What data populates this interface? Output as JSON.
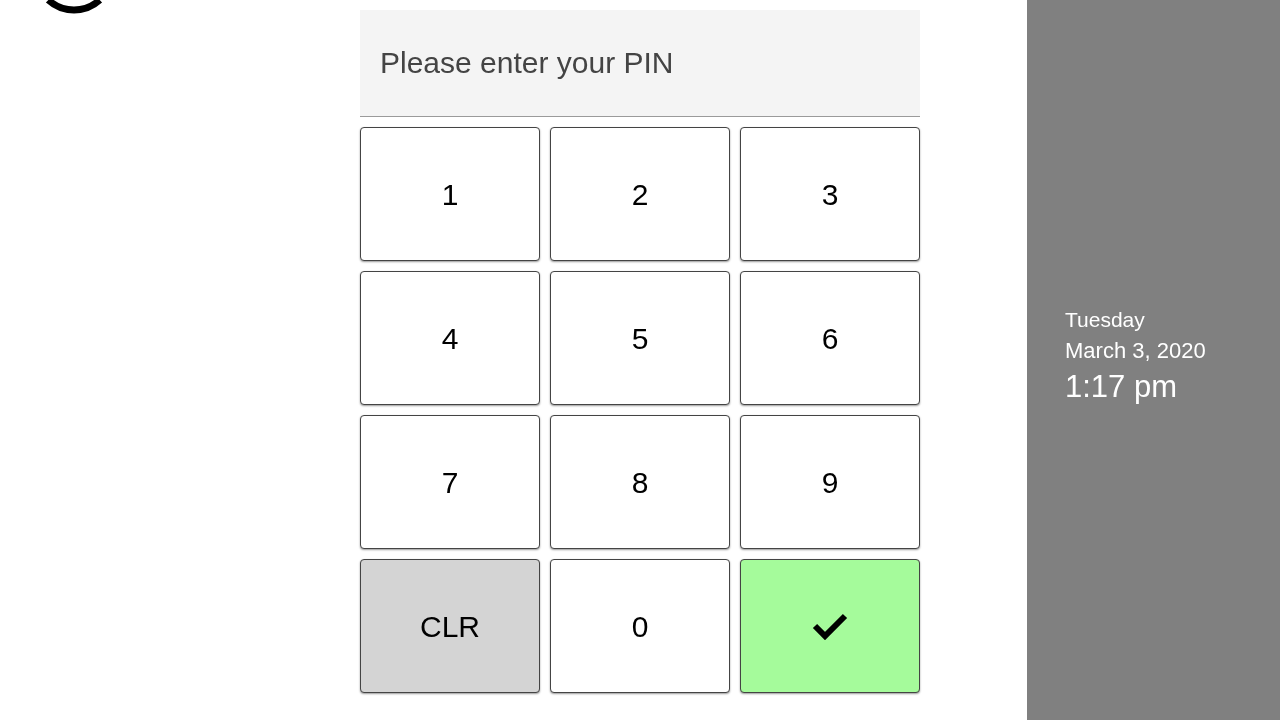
{
  "pin_field": {
    "placeholder": "Please enter your PIN"
  },
  "keys": [
    {
      "kind": "digit",
      "label": "1"
    },
    {
      "kind": "digit",
      "label": "2"
    },
    {
      "kind": "digit",
      "label": "3"
    },
    {
      "kind": "digit",
      "label": "4"
    },
    {
      "kind": "digit",
      "label": "5"
    },
    {
      "kind": "digit",
      "label": "6"
    },
    {
      "kind": "digit",
      "label": "7"
    },
    {
      "kind": "digit",
      "label": "8"
    },
    {
      "kind": "digit",
      "label": "9"
    },
    {
      "kind": "clear",
      "label": "CLR"
    },
    {
      "kind": "digit",
      "label": "0"
    },
    {
      "kind": "submit"
    }
  ],
  "side_panel": {
    "day": "Tuesday",
    "date": "March 3, 2020",
    "time": "1:17 pm"
  }
}
